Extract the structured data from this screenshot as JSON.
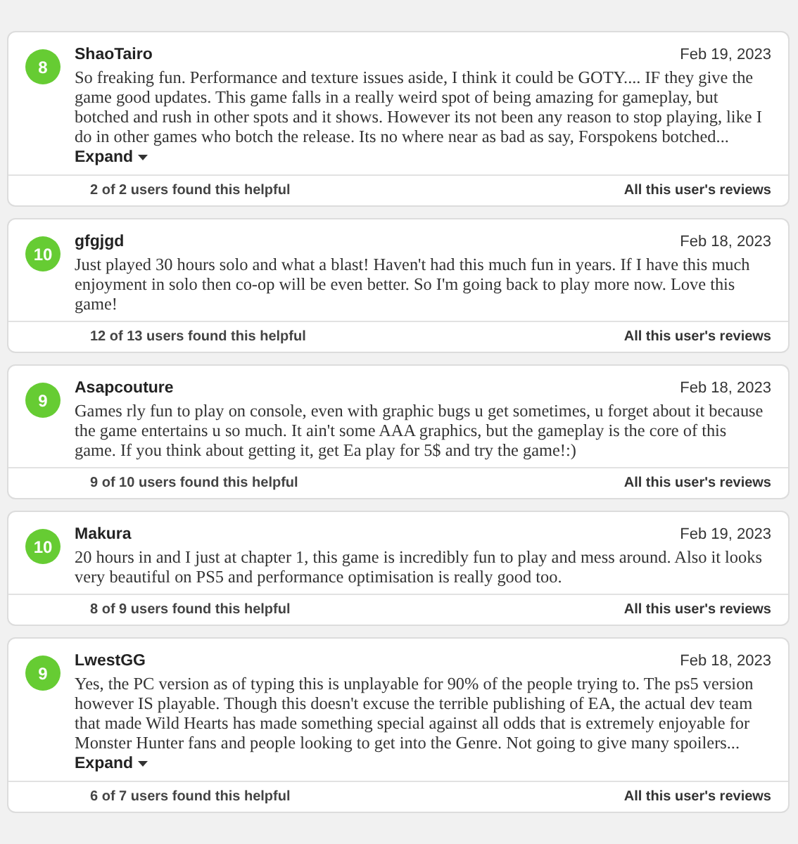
{
  "reviews": [
    {
      "score": "8",
      "user": "ShaoTairo",
      "date": "Feb 19, 2023",
      "text": "So freaking fun. Performance and texture issues aside, I think it could be GOTY.... IF they give the game good updates. This game falls in a really weird spot of being amazing for gameplay, but botched and rush in other spots and it shows. However its not been any reason to stop playing, like I do in other games who botch the release. Its no where near as bad as say, Forspokens botched...",
      "expand": "Expand",
      "helpful": "2 of 2 users found this helpful",
      "all_reviews": "All this user's reviews"
    },
    {
      "score": "10",
      "user": "gfgjgd",
      "date": "Feb 18, 2023",
      "text": "Just played 30 hours solo and what a blast! Haven't had this much fun in years. If I have this much enjoyment in solo then co-op will be even better. So I'm going back to play more now. Love this game!",
      "helpful": "12 of 13 users found this helpful",
      "all_reviews": "All this user's reviews"
    },
    {
      "score": "9",
      "user": "Asapcouture",
      "date": "Feb 18, 2023",
      "text": "Games rly fun to play on console, even with graphic bugs u get sometimes, u forget about it because the game entertains u so much. It ain't some AAA graphics, but the gameplay is the core of this game. If you think about getting it, get Ea play for 5$ and try the game!:)",
      "helpful": "9 of 10 users found this helpful",
      "all_reviews": "All this user's reviews"
    },
    {
      "score": "10",
      "user": "Makura",
      "date": "Feb 19, 2023",
      "text": "20 hours in and I just at chapter 1, this game is incredibly fun to play and mess around. Also it looks very beautiful on PS5 and performance optimisation is really good too.",
      "helpful": "8 of 9 users found this helpful",
      "all_reviews": "All this user's reviews"
    },
    {
      "score": "9",
      "user": "LwestGG",
      "date": "Feb 18, 2023",
      "text": "Yes, the PC version as of typing this is unplayable for 90% of the people trying to. The ps5 version however IS playable. Though this doesn't excuse the terrible publishing of EA, the actual dev team that made Wild Hearts has made something special against all odds that is extremely enjoyable for Monster Hunter fans and people looking to get into the Genre. Not going to give many spoilers...",
      "expand": "Expand",
      "helpful": "6 of 7 users found this helpful",
      "all_reviews": "All this user's reviews"
    }
  ]
}
